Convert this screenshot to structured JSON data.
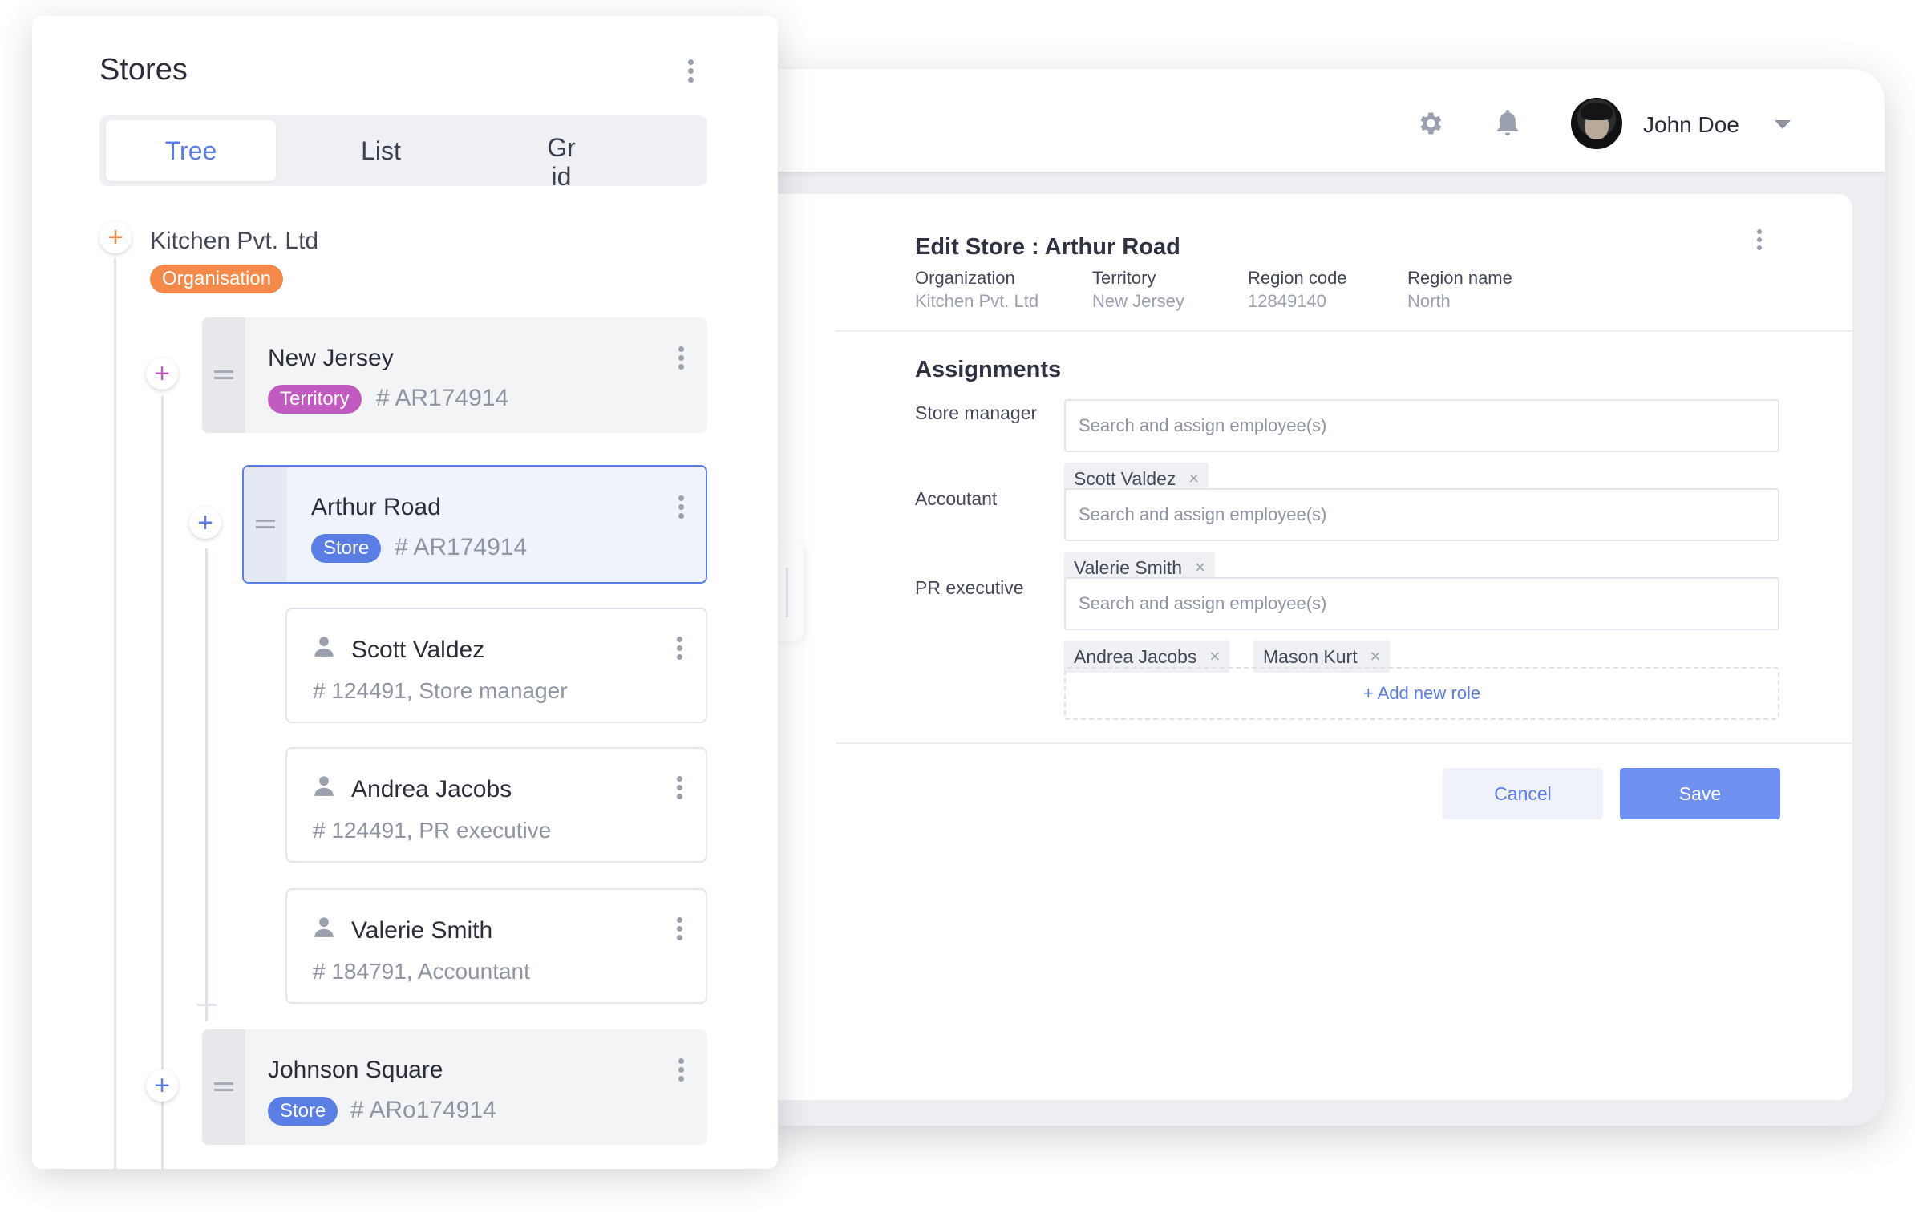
{
  "header": {
    "user_name": "John Doe",
    "icons": [
      "gear-icon",
      "bell-icon",
      "avatar",
      "chevron-down-icon"
    ]
  },
  "edit": {
    "title": "Edit Store : Arthur Road",
    "meta": [
      {
        "label": "Organization",
        "value": "Kitchen Pvt. Ltd"
      },
      {
        "label": "Territory",
        "value": "New Jersey"
      },
      {
        "label": "Region code",
        "value": "12849140"
      },
      {
        "label": "Region name",
        "value": "North"
      }
    ],
    "assignments_title": "Assignments",
    "search_placeholder": "Search and assign employee(s)",
    "roles": [
      {
        "label": "Store manager",
        "chips": [
          "Scott Valdez"
        ]
      },
      {
        "label": "Accoutant",
        "chips": [
          "Valerie Smith"
        ]
      },
      {
        "label": "PR executive",
        "chips": [
          "Andrea Jacobs",
          "Mason Kurt"
        ]
      }
    ],
    "chip_remove_symbol": "×",
    "add_role_label": "+ Add new role",
    "cancel_label": "Cancel",
    "save_label": "Save"
  },
  "stores": {
    "title": "Stores",
    "tabs": [
      "Tree",
      "List",
      "Grid"
    ],
    "active_tab": "Tree",
    "plus_symbol": "+",
    "organisation": {
      "name": "Kitchen Pvt. Ltd",
      "badge": "Organisation",
      "badge_color": "#f5894a"
    },
    "territory": {
      "name": "New Jersey",
      "badge": "Territory",
      "badge_color": "#c25bbf",
      "code": "# AR174914"
    },
    "selected_store": {
      "name": "Arthur Road",
      "badge": "Store",
      "badge_color": "#5b7ee5",
      "code": "# AR174914"
    },
    "employees": [
      {
        "name": "Scott Valdez",
        "sub": "# 124491, Store manager"
      },
      {
        "name": "Andrea Jacobs",
        "sub": "# 124491, PR executive"
      },
      {
        "name": "Valerie Smith",
        "sub": "# 184791, Accountant"
      }
    ],
    "other_store": {
      "name": "Johnson Square",
      "badge": "Store",
      "badge_color": "#5b7ee5",
      "code": "# ARo174914"
    }
  },
  "colors": {
    "accent": "#5b7ee5",
    "save": "#6f90ee",
    "plus_orange": "#f5894a",
    "plus_purple": "#c25bbf"
  }
}
